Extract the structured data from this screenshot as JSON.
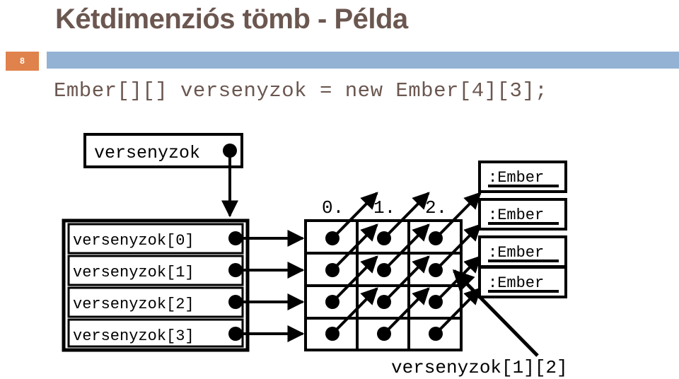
{
  "slide": {
    "title": "Kétdimenziós tömb - Példa",
    "page_number": "8",
    "code": "Ember[][] versenyzok = new Ember[4][3];",
    "accent_orange": "#E0824C",
    "accent_blue": "#94B3D4",
    "title_color": "#6B5750"
  },
  "diagram": {
    "pointer_box_label": "versenyzok",
    "row_labels": [
      "versenyzok[0]",
      "versenyzok[1]",
      "versenyzok[2]",
      "versenyzok[3]"
    ],
    "column_labels": [
      "0.",
      "1.",
      "2."
    ],
    "object_boxes": [
      ":Ember",
      ":Ember",
      ":Ember",
      ":Ember"
    ],
    "cell_callout_label": "versenyzok[1][2]",
    "grid_rows": 4,
    "grid_cols": 3,
    "stroke_color": "#000000"
  }
}
